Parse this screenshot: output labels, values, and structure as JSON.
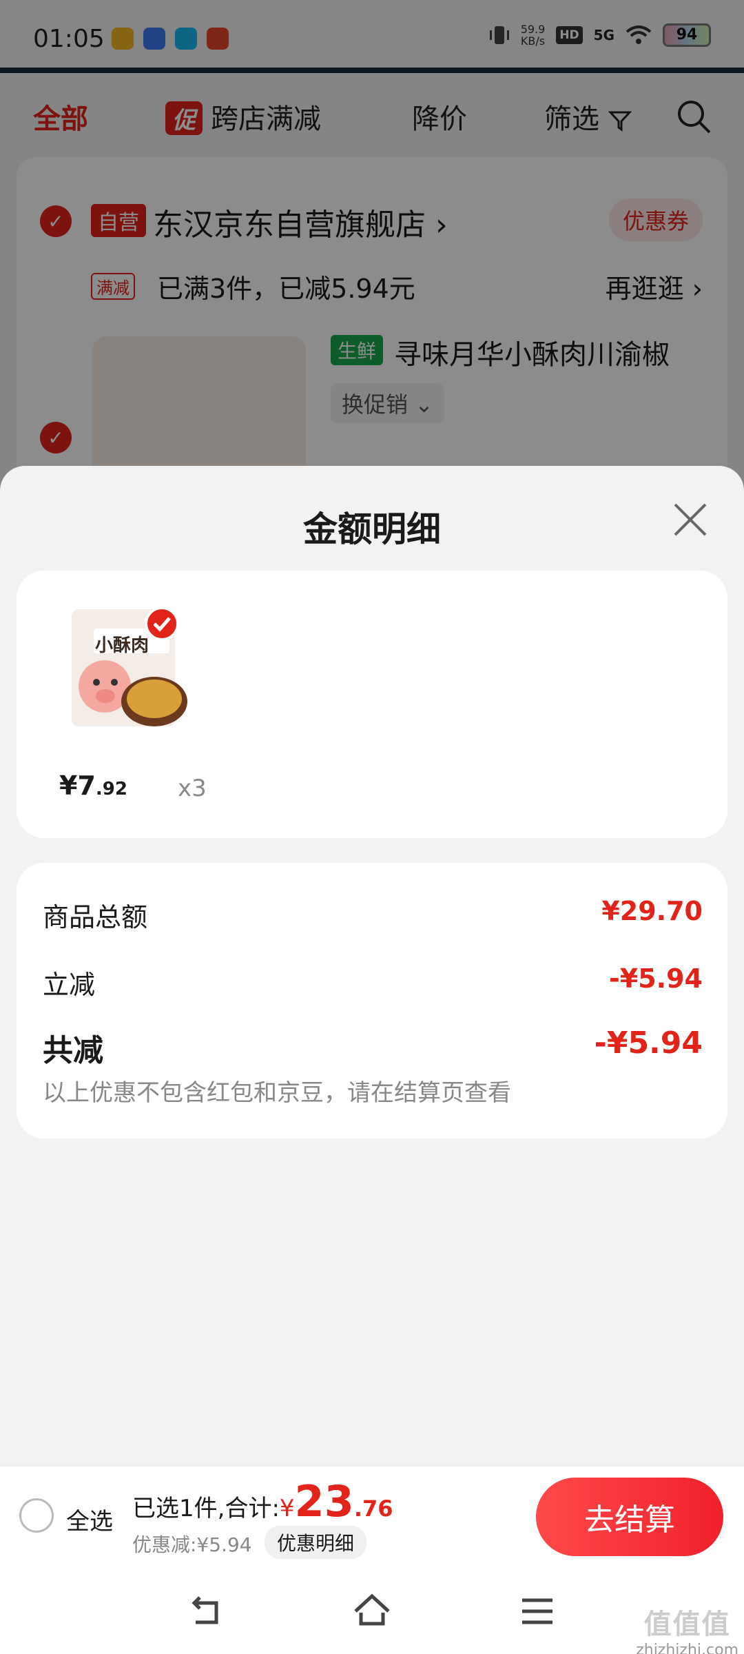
{
  "status_bar": {
    "time": "01:05",
    "speed_value": "59.9",
    "speed_unit": "KB/s",
    "hd": "HD",
    "network": "5G",
    "battery": "94"
  },
  "tabs": {
    "all": "全部",
    "promo_badge": "促",
    "cross_store": "跨店满减",
    "price_drop": "降价",
    "filter": "筛选"
  },
  "shop": {
    "self_operated_tag": "自营",
    "name": "东汉京东自营旗舰店 ›",
    "coupon": "优惠券",
    "promo_tag": "满减",
    "promo_text": "已满3件，已减5.94元",
    "browse_more": "再逛逛 ›",
    "product_tag": "生鲜",
    "product_name": "寻味月华小酥肉川渝椒",
    "change_promo": "换促销 ⌄"
  },
  "sheet": {
    "title": "金额明细",
    "item": {
      "price_int": "¥7",
      "price_dec": ".92",
      "qty": "x3",
      "thumb_label": "小酥肉"
    },
    "summary": {
      "goods_total_label": "商品总额",
      "goods_total_value": "¥29.70",
      "instant_off_label": "立减",
      "instant_off_value": "-¥5.94",
      "total_off_label": "共减",
      "total_off_value": "-¥5.94",
      "note": "以上优惠不包含红包和京豆，请在结算页查看"
    }
  },
  "checkout": {
    "select_all": "全选",
    "selected_text": "已选1件,合计:",
    "yen": "¥",
    "total_int": "23",
    "total_dec": ".76",
    "discount": "优惠减:¥5.94",
    "detail_btn": "优惠明细",
    "checkout_btn": "去结算"
  },
  "watermark": {
    "main": "值值值",
    "sub": "zhizhizhi.com"
  },
  "colors": {
    "accent": "#e2231a",
    "sheet_bg": "#f2f2f2"
  }
}
